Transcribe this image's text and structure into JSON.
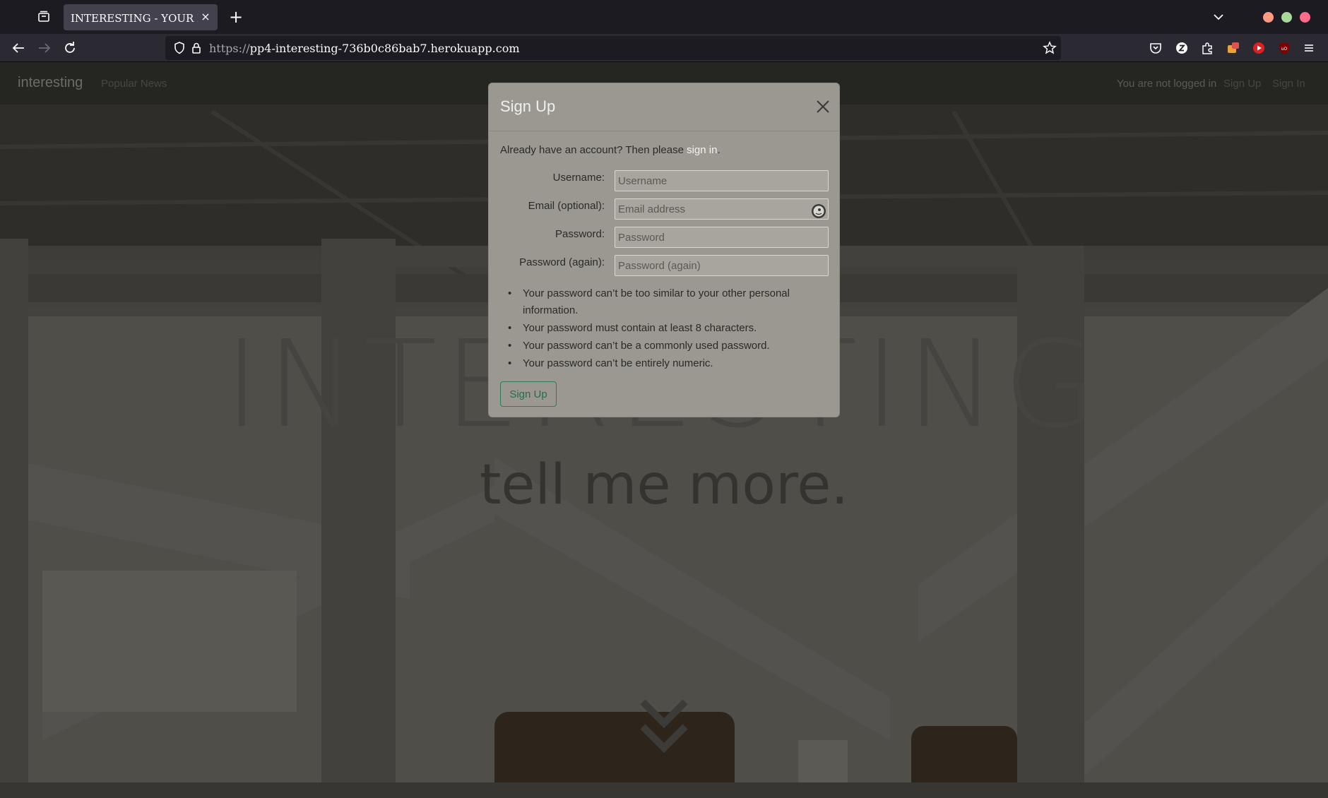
{
  "browser": {
    "tab_title": "INTERESTING - YOUR NEW",
    "tab_close": "×",
    "new_tab": "+",
    "url_scheme": "https://",
    "url_host": "pp4-interesting-736b0c86bab7.herokuapp.com"
  },
  "site": {
    "brand": "interesting",
    "nav_popular": "Popular News",
    "login_status": "You are not logged in",
    "nav_signup": "Sign Up",
    "nav_signin": "Sign In",
    "hero_title": "INTERESTING",
    "hero_subtitle": "tell me more."
  },
  "modal": {
    "title": "Sign Up",
    "intro_text": "Already have an account? Then please ",
    "intro_link": "sign in",
    "intro_end": ".",
    "fields": {
      "username_label": "Username:",
      "username_placeholder": "Username",
      "email_label": "Email (optional):",
      "email_placeholder": "Email address",
      "password_label": "Password:",
      "password_placeholder": "Password",
      "password2_label": "Password (again):",
      "password2_placeholder": "Password (again)"
    },
    "rules": [
      "Your password can’t be too similar to your other personal information.",
      "Your password must contain at least 8 characters.",
      "Your password can’t be a commonly used password.",
      "Your password can’t be entirely numeric."
    ],
    "submit_label": "Sign Up"
  },
  "colors": {
    "accent_green": "#2b6b4c",
    "window_close": "#ff6159",
    "window_min": "#ffbd2e",
    "window_max": "#28c941"
  }
}
